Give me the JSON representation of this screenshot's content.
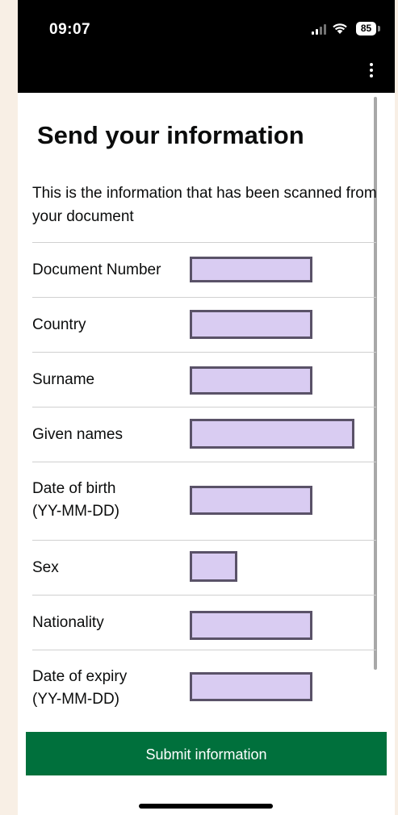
{
  "status_bar": {
    "time": "09:07",
    "battery": "85"
  },
  "page": {
    "title": "Send your information",
    "intro": "This is the information that has been scanned from your document"
  },
  "fields": [
    {
      "label": "Document Number",
      "value": ""
    },
    {
      "label": "Country",
      "value": ""
    },
    {
      "label": "Surname",
      "value": ""
    },
    {
      "label": "Given names",
      "value": ""
    },
    {
      "label": "Date of birth\n(YY-MM-DD)",
      "value": ""
    },
    {
      "label": "Sex",
      "value": ""
    },
    {
      "label": "Nationality",
      "value": ""
    },
    {
      "label": "Date of expiry\n(YY-MM-DD)",
      "value": ""
    }
  ],
  "submit": {
    "label": "Submit information"
  },
  "colors": {
    "field_fill": "#d9ccf2",
    "field_border": "#5a5268",
    "submit_green": "#00703c",
    "page_background": "#f8efe5"
  },
  "icons": [
    "signal-icon",
    "wifi-icon",
    "battery-icon",
    "more-options-icon"
  ]
}
